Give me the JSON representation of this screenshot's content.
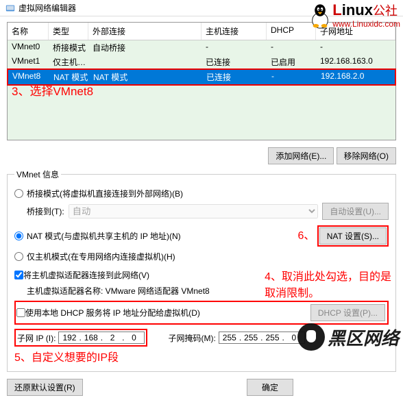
{
  "title": "虚拟网络编辑器",
  "logo": {
    "brand": "Linux",
    "suffix": "公社",
    "url": "www.Linuxidc.com"
  },
  "table": {
    "headers": {
      "name": "名称",
      "type": "类型",
      "ext": "外部连接",
      "host": "主机连接",
      "dhcp": "DHCP",
      "sub": "子网地址"
    },
    "rows": [
      {
        "name": "VMnet0",
        "type": "桥接模式",
        "ext": "自动桥接",
        "host": "-",
        "dhcp": "-",
        "sub": "-"
      },
      {
        "name": "VMnet1",
        "type": "仅主机…",
        "ext": "",
        "host": "已连接",
        "dhcp": "已启用",
        "sub": "192.168.163.0"
      },
      {
        "name": "VMnet8",
        "type": "NAT 模式",
        "ext": "NAT 模式",
        "host": "已连接",
        "dhcp": "-",
        "sub": "192.168.2.0"
      }
    ]
  },
  "annotations": {
    "a3": "3、选择VMnet8",
    "a4a": "4、取消此处勾选，目的是",
    "a4b": "取消限制。",
    "a5": "5、自定义想要的IP段",
    "a6": "6、"
  },
  "buttons": {
    "addNet": "添加网络(E)...",
    "removeNet": "移除网络(O)",
    "autoSet": "自动设置(U)...",
    "natSet": "NAT 设置(S)...",
    "dhcpSet": "DHCP 设置(P)...",
    "restore": "还原默认设置(R)",
    "ok": "确定"
  },
  "groupTitle": "VMnet 信息",
  "radios": {
    "bridge": "桥接模式(将虚拟机直接连接到外部网络)(B)",
    "bridgeToLabel": "桥接到(T):",
    "bridgeAuto": "自动",
    "nat": "NAT 模式(与虚拟机共享主机的 IP 地址)(N)",
    "hostOnly": "仅主机模式(在专用网络内连接虚拟机)(H)"
  },
  "checks": {
    "connectHost": "将主机虚拟适配器连接到此网络(V)",
    "adapterLabel": "主机虚拟适配器名称: VMware 网络适配器 VMnet8",
    "useDhcp": "使用本地 DHCP 服务将 IP 地址分配给虚拟机(D)"
  },
  "subnet": {
    "ipLabel": "子网 IP (I):",
    "maskLabel": "子网掩码(M):",
    "ip": [
      "192",
      "168",
      "2",
      "0"
    ],
    "mask": [
      "255",
      "255",
      "255",
      "0"
    ]
  },
  "bottomLogo": "黑区网络"
}
